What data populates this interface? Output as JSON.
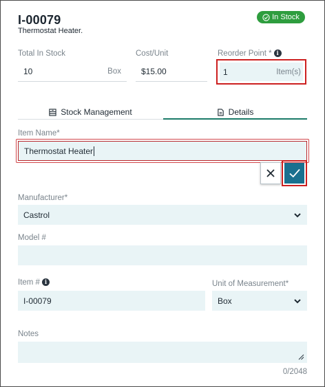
{
  "header": {
    "item_id": "I-00079",
    "item_subtitle": "Thermostat Heater.",
    "status_badge": "In Stock",
    "status_color": "#2e9d3e"
  },
  "summary": {
    "total_in_stock_label": "Total In Stock",
    "total_in_stock_value": "10",
    "total_in_stock_unit": "Box",
    "cost_unit_label": "Cost/Unit",
    "cost_unit_value": "$15.00",
    "reorder_point_label": "Reorder Point *",
    "reorder_point_value": "1",
    "reorder_point_unit": "Item(s)"
  },
  "tabs": [
    {
      "label": "Stock Management",
      "icon": "inventory-icon",
      "active": false
    },
    {
      "label": "Details",
      "icon": "document-icon",
      "active": true
    }
  ],
  "form": {
    "item_name_label": "Item Name*",
    "item_name_value": "Thermostat Heater",
    "manufacturer_label": "Manufacturer*",
    "manufacturer_value": "Castrol",
    "model_label": "Model #",
    "model_value": "",
    "item_number_label": "Item #",
    "item_number_value": "I-00079",
    "unit_label": "Unit of Measurement*",
    "unit_value": "Box",
    "notes_label": "Notes",
    "notes_value": "",
    "notes_counter": "0/2048"
  },
  "colors": {
    "accent": "#1b7a68",
    "confirm": "#19708f",
    "field_bg": "#e9f4f6",
    "highlight": "#cc1f1f"
  }
}
